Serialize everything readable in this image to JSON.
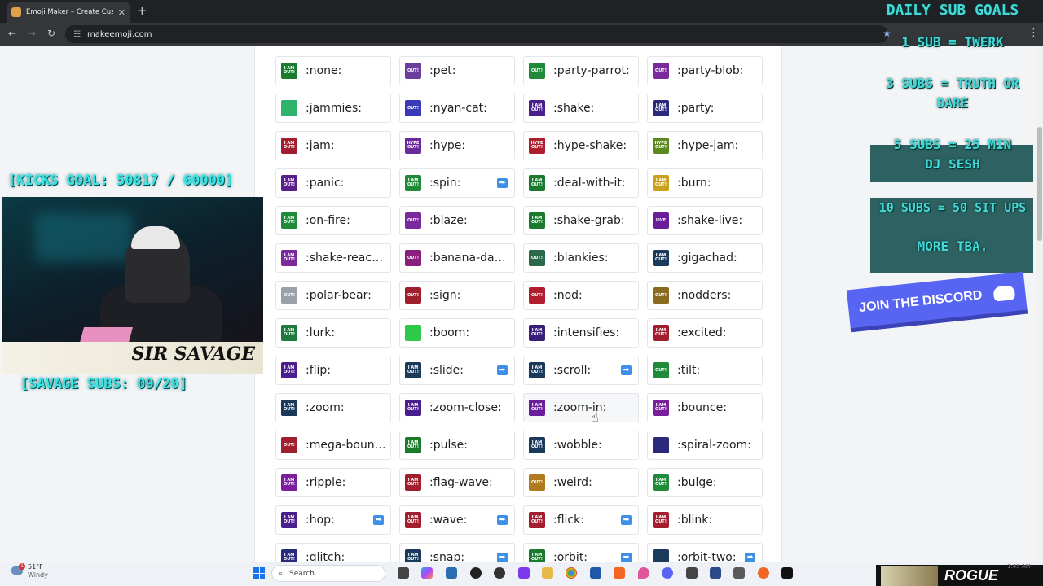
{
  "browser": {
    "tab_title": "Emoji Maker – Create Custom E",
    "url": "makeemoji.com"
  },
  "emojis": [
    {
      "name": ":none:",
      "color": "#1a7a2e",
      "label": "I AM OUT!",
      "arrow": false
    },
    {
      "name": ":pet:",
      "color": "#6a3e9c",
      "label": "OUT!",
      "arrow": false
    },
    {
      "name": ":party-parrot:",
      "color": "#1e8a3a",
      "label": "OUT!",
      "arrow": false
    },
    {
      "name": ":party-blob:",
      "color": "#7a2a9c",
      "label": "OUT!",
      "arrow": false
    },
    {
      "name": ":jammies:",
      "color": "#2fb36a",
      "label": "",
      "arrow": false
    },
    {
      "name": ":nyan-cat:",
      "color": "#3a3ab8",
      "label": "OUT!",
      "arrow": false
    },
    {
      "name": ":shake:",
      "color": "#4a1e8c",
      "label": "I AM OUT!",
      "arrow": false
    },
    {
      "name": ":party:",
      "color": "#2a2a7c",
      "label": "I AM OUT!",
      "arrow": false
    },
    {
      "name": ":jam:",
      "color": "#a01e2e",
      "label": "I AM OUT!",
      "arrow": false
    },
    {
      "name": ":hype:",
      "color": "#6a2a9c",
      "label": "HYPE OUT!",
      "arrow": false
    },
    {
      "name": ":hype-shake:",
      "color": "#b01e2e",
      "label": "HYPE OUT!",
      "arrow": false
    },
    {
      "name": ":hype-jam:",
      "color": "#5a8a1e",
      "label": "HYPE OUT!",
      "arrow": false
    },
    {
      "name": ":panic:",
      "color": "#5a1e8c",
      "label": "I AM OUT!",
      "arrow": false
    },
    {
      "name": ":spin:",
      "color": "#1e8a3a",
      "label": "I AM OUT!",
      "arrow": true
    },
    {
      "name": ":deal-with-it:",
      "color": "#1a7a2e",
      "label": "I AM OUT!",
      "arrow": false
    },
    {
      "name": ":burn:",
      "color": "#c9a01e",
      "label": "I AM OUT!",
      "arrow": false
    },
    {
      "name": ":on-fire:",
      "color": "#1e8a3a",
      "label": "I AM OUT!",
      "arrow": false
    },
    {
      "name": ":blaze:",
      "color": "#7a2a9c",
      "label": "OUT!",
      "arrow": false
    },
    {
      "name": ":shake-grab:",
      "color": "#1a7a2e",
      "label": "I AM OUT!",
      "arrow": false
    },
    {
      "name": ":shake-live:",
      "color": "#6a1e9c",
      "label": "LIVE",
      "arrow": false
    },
    {
      "name": ":shake-react…",
      "color": "#7a2a9c",
      "label": "I AM OUT!",
      "arrow": false
    },
    {
      "name": ":banana-da…",
      "color": "#8a1e7c",
      "label": "OUT!",
      "arrow": false
    },
    {
      "name": ":blankies:",
      "color": "#2a6a4a",
      "label": "OUT!",
      "arrow": false
    },
    {
      "name": ":gigachad:",
      "color": "#1a3a5a",
      "label": "I AM OUT!",
      "arrow": false
    },
    {
      "name": ":polar-bear:",
      "color": "#9aa0a8",
      "label": "OUT!",
      "arrow": false
    },
    {
      "name": ":sign:",
      "color": "#a01e2e",
      "label": "OUT!",
      "arrow": false
    },
    {
      "name": ":nod:",
      "color": "#b01e2e",
      "label": "OUT!",
      "arrow": false
    },
    {
      "name": ":nodders:",
      "color": "#8a6a1e",
      "label": "OUT!",
      "arrow": false
    },
    {
      "name": ":lurk:",
      "color": "#1e7a3a",
      "label": "I AM OUT!",
      "arrow": false
    },
    {
      "name": ":boom:",
      "color": "#2ec94a",
      "label": "",
      "arrow": false
    },
    {
      "name": ":intensifies:",
      "color": "#3a1e7c",
      "label": "I AM OUT!",
      "arrow": false
    },
    {
      "name": ":excited:",
      "color": "#a01e2e",
      "label": "I AM OUT!",
      "arrow": false
    },
    {
      "name": ":flip:",
      "color": "#4a1e8c",
      "label": "I AM OUT!",
      "arrow": false
    },
    {
      "name": ":slide:",
      "color": "#1a3a5a",
      "label": "I AM OUT!",
      "arrow": true
    },
    {
      "name": ":scroll:",
      "color": "#1a3a5a",
      "label": "I AM OUT!",
      "arrow": true
    },
    {
      "name": ":tilt:",
      "color": "#1e8a3a",
      "label": "OUT!",
      "arrow": false
    },
    {
      "name": ":zoom:",
      "color": "#1a3a5a",
      "label": "I AM OUT!",
      "arrow": false
    },
    {
      "name": ":zoom-close:",
      "color": "#4a1e8c",
      "label": "I AM OUT!",
      "arrow": false
    },
    {
      "name": ":zoom-in:",
      "color": "#6a1e9c",
      "label": "I AM OUT!",
      "arrow": false
    },
    {
      "name": ":bounce:",
      "color": "#7a1e9c",
      "label": "I AM OUT!",
      "arrow": false
    },
    {
      "name": ":mega-boun…",
      "color": "#a01e2e",
      "label": "OUT!",
      "arrow": false
    },
    {
      "name": ":pulse:",
      "color": "#1a7a2e",
      "label": "I AM OUT!",
      "arrow": false
    },
    {
      "name": ":wobble:",
      "color": "#1a3a5a",
      "label": "I AM OUT!",
      "arrow": false
    },
    {
      "name": ":spiral-zoom:",
      "color": "#2a2a7c",
      "label": "",
      "arrow": false
    },
    {
      "name": ":ripple:",
      "color": "#7a1e9c",
      "label": "I AM OUT!",
      "arrow": false
    },
    {
      "name": ":flag-wave:",
      "color": "#a01e2e",
      "label": "I AM OUT!",
      "arrow": false
    },
    {
      "name": ":weird:",
      "color": "#b07a1e",
      "label": "OUT!",
      "arrow": false
    },
    {
      "name": ":bulge:",
      "color": "#1e8a3a",
      "label": "I AM OUT!",
      "arrow": false
    },
    {
      "name": ":hop:",
      "color": "#4a1e8c",
      "label": "I AM OUT!",
      "arrow": true
    },
    {
      "name": ":wave:",
      "color": "#a01e2e",
      "label": "I AM OUT!",
      "arrow": true
    },
    {
      "name": ":flick:",
      "color": "#a01e2e",
      "label": "I AM OUT!",
      "arrow": true
    },
    {
      "name": ":blink:",
      "color": "#a01e2e",
      "label": "I AM OUT!",
      "arrow": false
    },
    {
      "name": ":glitch:",
      "color": "#2a2a7c",
      "label": "I AM OUT!",
      "arrow": false
    },
    {
      "name": ":snap:",
      "color": "#1a3a5a",
      "label": "I AM OUT!",
      "arrow": true
    },
    {
      "name": ":orbit:",
      "color": "#1a7a2e",
      "label": "I AM OUT!",
      "arrow": true
    },
    {
      "name": ":orbit-two:",
      "color": "#1a3a5a",
      "label": "",
      "arrow": true
    }
  ],
  "overlay": {
    "kicks_goal": "[KICKS GOAL: 50817 / 60000]",
    "savage_subs": "[SAVAGE SUBS: 09/20]",
    "cam_name": "SIR SAVAGE",
    "goals_title": "DAILY SUB GOALS",
    "goal_1": "1 SUB = TWERK",
    "goal_3a": "3 SUBS = TRUTH OR",
    "goal_3b": "DARE",
    "goal_5a": "5 SUBS = 25 MIN",
    "goal_5b": "DJ SESH",
    "goal_10": "10 SUBS = 50 SIT UPS",
    "goal_more": "MORE TBA.",
    "discord": "JOIN THE DISCORD"
  },
  "taskbar": {
    "temp": "51°F",
    "condition": "Windy",
    "notification_count": "1",
    "search_placeholder": "Search",
    "sponsor": "ROGUE",
    "clock": "1:45 AM"
  }
}
